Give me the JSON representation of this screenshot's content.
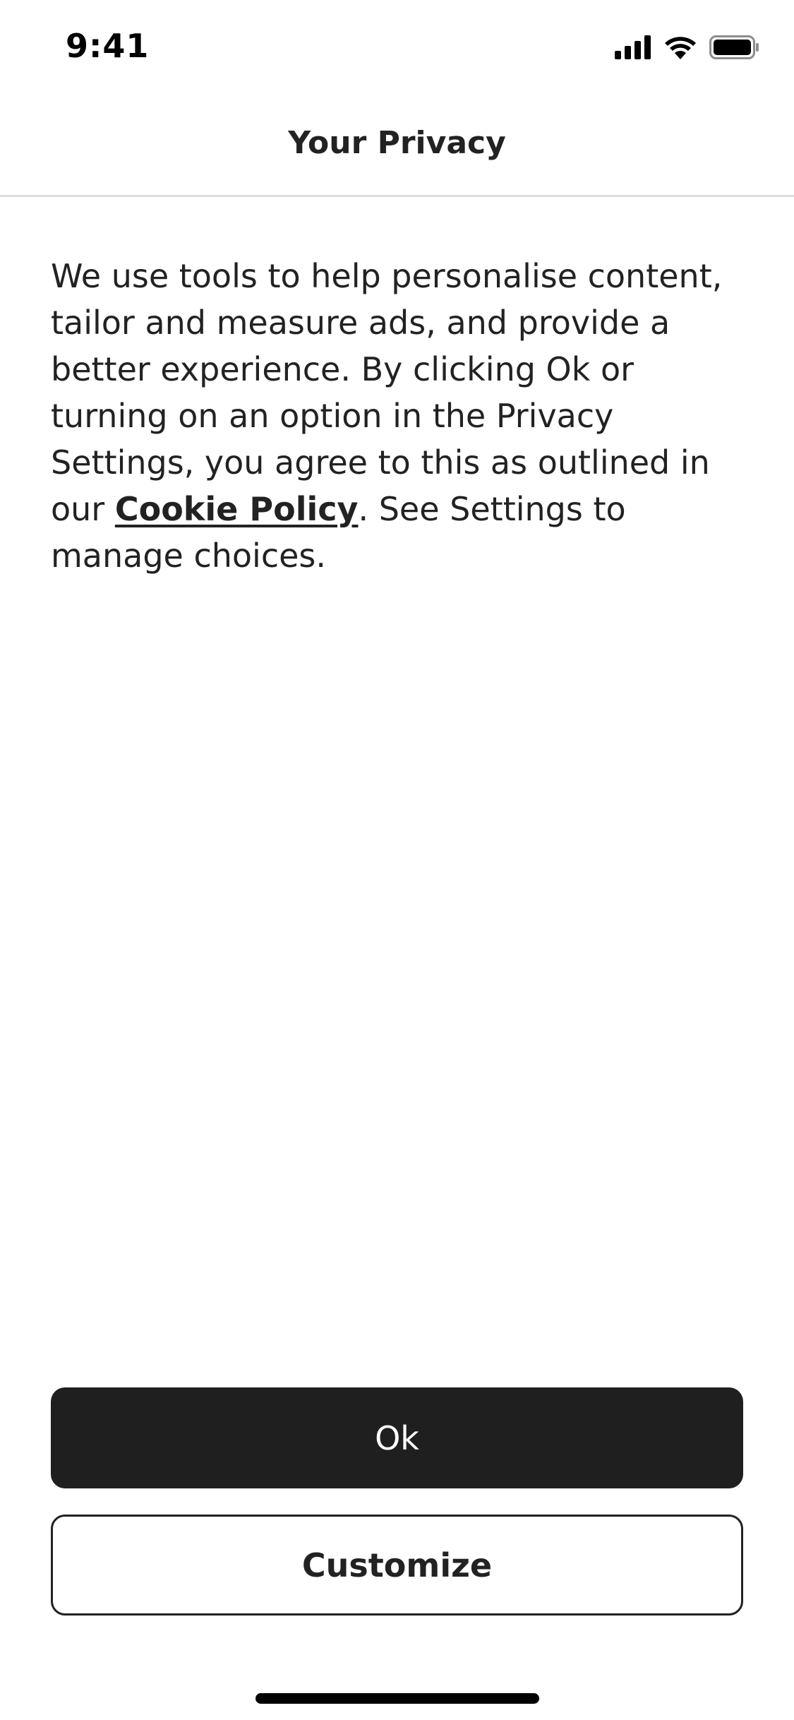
{
  "status_bar": {
    "time": "9:41",
    "icons": [
      "cellular-signal-icon",
      "wifi-icon",
      "battery-icon"
    ]
  },
  "header": {
    "title": "Your Privacy"
  },
  "content": {
    "text_before_link": "We use tools to help personalise content, tailor and measure ads, and provide a better experience. By clicking Ok or turning on an option in the Privacy Settings, you agree to this as outlined in our ",
    "link_text": "Cookie Policy",
    "text_after_link": ". See Settings to manage choices."
  },
  "buttons": {
    "ok_label": "Ok",
    "customize_label": "Customize"
  },
  "colors": {
    "primary_button": "#1f1f1f",
    "text": "#222222",
    "divider": "#dddddd"
  }
}
